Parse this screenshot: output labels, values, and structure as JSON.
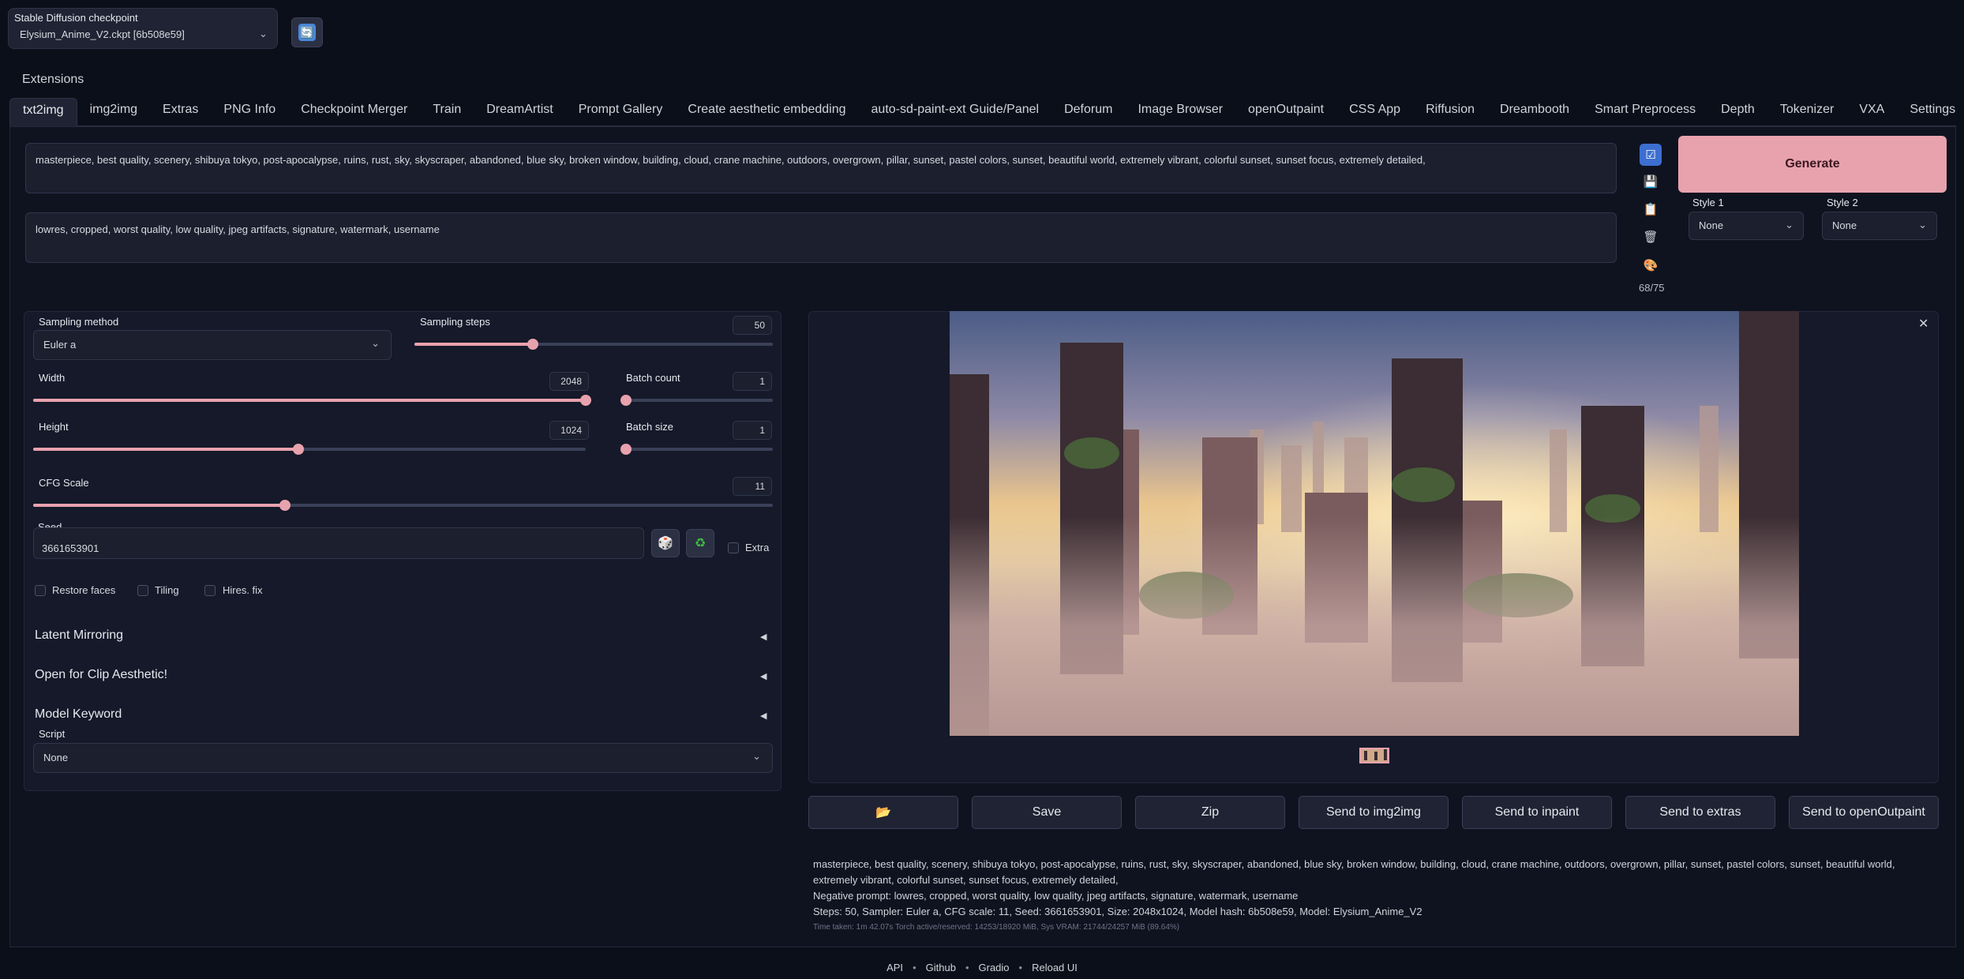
{
  "checkpoint": {
    "label": "Stable Diffusion checkpoint",
    "value": "Elysium_Anime_V2.ckpt [6b508e59]",
    "refresh_icon": "refresh-icon"
  },
  "extensions_label": "Extensions",
  "tabs": [
    {
      "label": "txt2img",
      "active": true
    },
    {
      "label": "img2img"
    },
    {
      "label": "Extras"
    },
    {
      "label": "PNG Info"
    },
    {
      "label": "Checkpoint Merger"
    },
    {
      "label": "Train"
    },
    {
      "label": "DreamArtist"
    },
    {
      "label": "Prompt Gallery"
    },
    {
      "label": "Create aesthetic embedding"
    },
    {
      "label": "auto-sd-paint-ext Guide/Panel"
    },
    {
      "label": "Deforum"
    },
    {
      "label": "Image Browser"
    },
    {
      "label": "openOutpaint"
    },
    {
      "label": "CSS App"
    },
    {
      "label": "Riffusion"
    },
    {
      "label": "Dreambooth"
    },
    {
      "label": "Smart Preprocess"
    },
    {
      "label": "Depth"
    },
    {
      "label": "Tokenizer"
    },
    {
      "label": "VXA"
    },
    {
      "label": "Settings"
    }
  ],
  "prompt": "masterpiece, best quality, scenery, shibuya tokyo, post-apocalypse, ruins, rust, sky, skyscraper, abandoned, blue sky, broken window, building, cloud, crane machine, outdoors, overgrown, pillar, sunset, pastel colors, sunset, beautiful world, extremely vibrant, colorful sunset, sunset focus, extremely detailed,",
  "negative_prompt": "lowres, cropped, worst quality, low quality, jpeg artifacts, signature, watermark, username",
  "token_count": "68/75",
  "generate_label": "Generate",
  "styles": {
    "style1_label": "Style 1",
    "style1_value": "None",
    "style2_label": "Style 2",
    "style2_value": "None"
  },
  "settings": {
    "sampling_method_label": "Sampling method",
    "sampling_method_value": "Euler a",
    "sampling_steps_label": "Sampling steps",
    "sampling_steps_value": "50",
    "sampling_steps_fraction": 0.33,
    "width_label": "Width",
    "width_value": "2048",
    "width_fraction": 1.0,
    "height_label": "Height",
    "height_value": "1024",
    "height_fraction": 0.48,
    "batch_count_label": "Batch count",
    "batch_count_value": "1",
    "batch_size_label": "Batch size",
    "batch_size_value": "1",
    "cfg_label": "CFG Scale",
    "cfg_value": "11",
    "cfg_fraction": 0.34,
    "seed_label": "Seed",
    "seed_value": "3661653901",
    "extra_label": "Extra",
    "restore_faces_label": "Restore faces",
    "tiling_label": "Tiling",
    "hires_label": "Hires. fix",
    "accordion_latent": "Latent Mirroring",
    "accordion_clip": "Open for Clip Aesthetic!",
    "accordion_model": "Model Keyword",
    "script_label": "Script",
    "script_value": "None"
  },
  "actions": {
    "folder_icon": "📂",
    "save": "Save",
    "zip": "Zip",
    "send_img2img": "Send to img2img",
    "send_inpaint": "Send to inpaint",
    "send_extras": "Send to extras",
    "send_outpaint": "Send to openOutpaint"
  },
  "info": {
    "prompt_line": "masterpiece, best quality, scenery, shibuya tokyo, post-apocalypse, ruins, rust, sky, skyscraper, abandoned, blue sky, broken window, building, cloud, crane machine, outdoors, overgrown, pillar, sunset, pastel colors, sunset, beautiful world, extremely vibrant, colorful sunset, sunset focus, extremely detailed,",
    "negative_line": "Negative prompt: lowres, cropped, worst quality, low quality, jpeg artifacts, signature, watermark, username",
    "params_line": "Steps: 50, Sampler: Euler a, CFG scale: 11, Seed: 3661653901, Size: 2048x1024, Model hash: 6b508e59, Model: Elysium_Anime_V2",
    "time_line": "Time taken: 1m 42.07s  Torch active/reserved: 14253/18920 MiB, Sys VRAM: 21744/24257 MiB (89.64%)"
  },
  "footer": {
    "api": "API",
    "github": "Github",
    "gradio": "Gradio",
    "reload": "Reload UI"
  },
  "colors": {
    "accent": "#e8a2ad",
    "background": "#0b0f19"
  }
}
